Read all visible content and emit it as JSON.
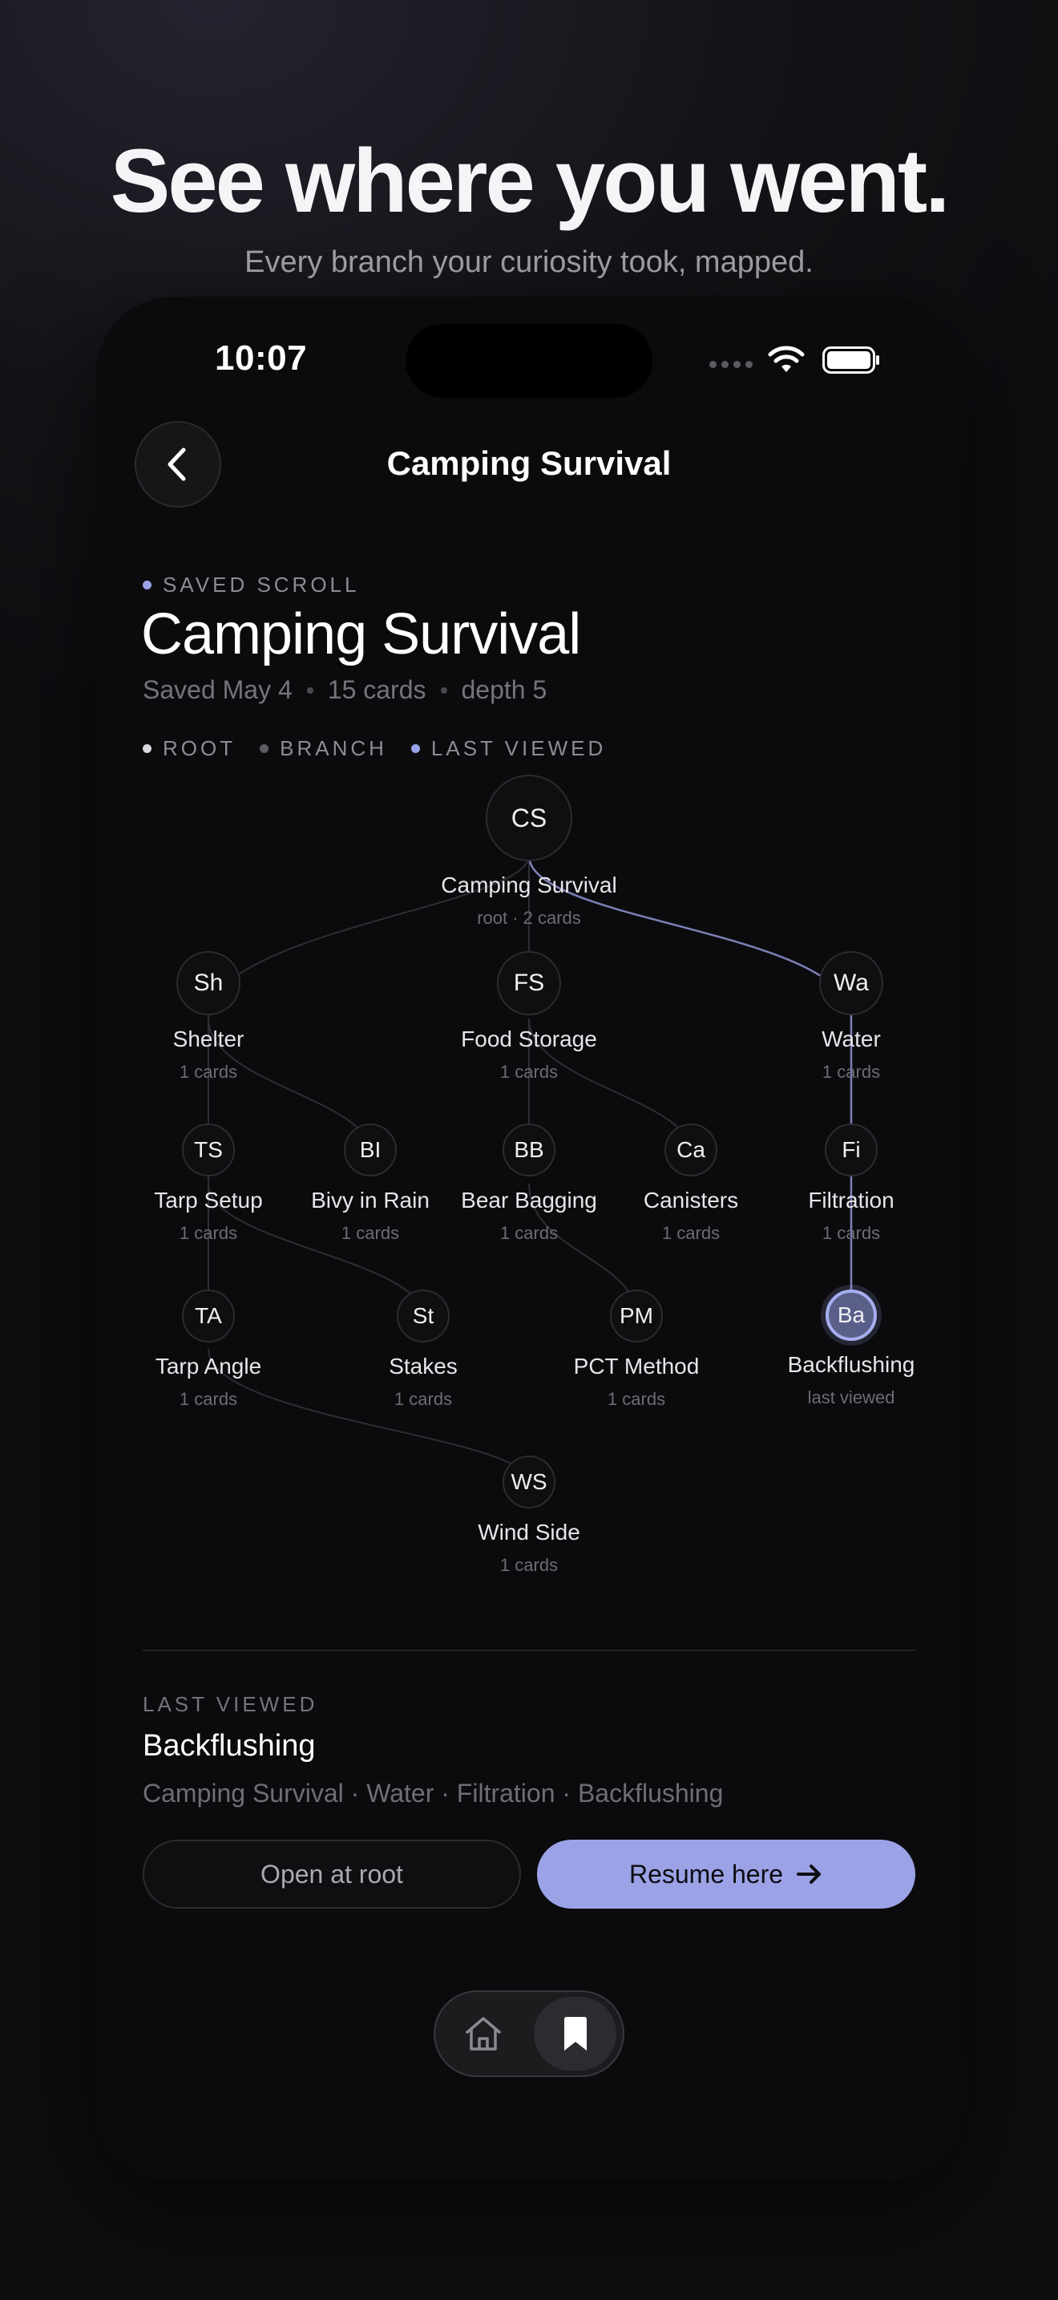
{
  "promo": {
    "title": "See where you went.",
    "subtitle": "Every branch your curiosity took, mapped."
  },
  "status_bar": {
    "time": "10:07"
  },
  "nav": {
    "title": "Camping Survival",
    "back_icon": "chevron-left-icon"
  },
  "header": {
    "eyebrow": "SAVED SCROLL",
    "title": "Camping Survival",
    "saved": "Saved May 4",
    "cards": "15 cards",
    "depth": "depth 5"
  },
  "legend": {
    "root": "ROOT",
    "branch": "BRANCH",
    "last_viewed": "LAST VIEWED",
    "colors": {
      "root": "#d8d8dc",
      "branch": "#5c5c62",
      "last_viewed": "#9aa3e8"
    }
  },
  "tree": {
    "nodes": [
      {
        "id": "cs",
        "abbr": "CS",
        "label": "Camping Survival",
        "sub": "root · 2 cards"
      },
      {
        "id": "sh",
        "abbr": "Sh",
        "label": "Shelter",
        "sub": "1 cards"
      },
      {
        "id": "fs",
        "abbr": "FS",
        "label": "Food Storage",
        "sub": "1 cards"
      },
      {
        "id": "wa",
        "abbr": "Wa",
        "label": "Water",
        "sub": "1 cards"
      },
      {
        "id": "ts",
        "abbr": "TS",
        "label": "Tarp Setup",
        "sub": "1 cards"
      },
      {
        "id": "bi",
        "abbr": "BI",
        "label": "Bivy in Rain",
        "sub": "1 cards"
      },
      {
        "id": "bb",
        "abbr": "BB",
        "label": "Bear Bagging",
        "sub": "1 cards"
      },
      {
        "id": "ca",
        "abbr": "Ca",
        "label": "Canisters",
        "sub": "1 cards"
      },
      {
        "id": "fi",
        "abbr": "Fi",
        "label": "Filtration",
        "sub": "1 cards"
      },
      {
        "id": "ta",
        "abbr": "TA",
        "label": "Tarp Angle",
        "sub": "1 cards"
      },
      {
        "id": "st",
        "abbr": "St",
        "label": "Stakes",
        "sub": "1 cards"
      },
      {
        "id": "pm",
        "abbr": "PM",
        "label": "PCT Method",
        "sub": "1 cards"
      },
      {
        "id": "ba",
        "abbr": "Ba",
        "label": "Backflushing",
        "sub": "last viewed"
      },
      {
        "id": "ws",
        "abbr": "WS",
        "label": "Wind Side",
        "sub": "1 cards"
      }
    ]
  },
  "last_viewed": {
    "eyebrow": "LAST VIEWED",
    "title": "Backflushing",
    "path": "Camping Survival · Water · Filtration · Backflushing"
  },
  "actions": {
    "open_root": "Open at root",
    "resume": "Resume here"
  },
  "tabbar": {
    "home_icon": "home-icon",
    "saved_icon": "bookmark-icon"
  }
}
